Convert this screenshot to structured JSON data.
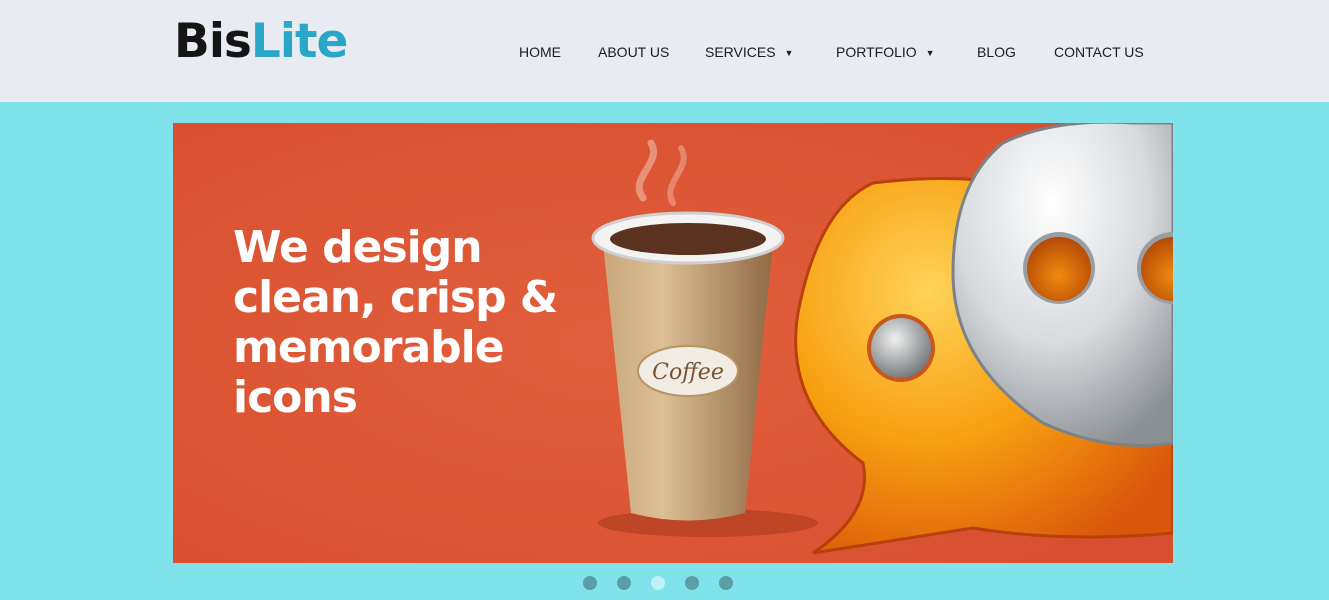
{
  "brand": {
    "part1": "Bis",
    "part2": "Lite"
  },
  "nav": {
    "home": "HOME",
    "about": "ABOUT US",
    "services": "SERVICES",
    "portfolio": "PORTFOLIO",
    "blog": "BLOG",
    "contact": "CONTACT US"
  },
  "icons": {
    "dropdown": "chevron-down-icon"
  },
  "hero": {
    "line1": "We design",
    "line2": "clean, crisp &",
    "line3": "memorable",
    "line4": "icons",
    "cup_label": "Coffee"
  },
  "slider": {
    "total_slides": 5,
    "active_slide": 3
  },
  "colors": {
    "page_bg": "#80e3ec",
    "header_bg": "#e8ebf2",
    "brand_accent": "#2aa7c6",
    "slide_bg": "#dd5634"
  }
}
